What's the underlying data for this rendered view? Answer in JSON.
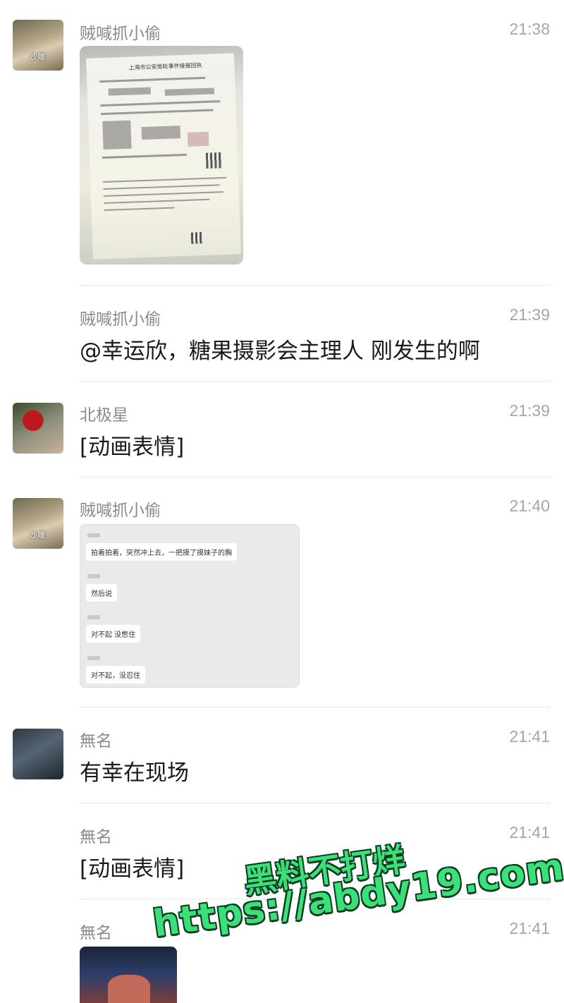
{
  "messages": [
    {
      "sender": "贼喊抓小偷",
      "time": "21:38",
      "type": "image",
      "image": "document-photo"
    },
    {
      "sender": "贼喊抓小偷",
      "time": "21:39",
      "type": "text",
      "text": "@幸运欣，糖果摄影会主理人 刚发生的啊"
    },
    {
      "sender": "北极星",
      "time": "21:39",
      "type": "text",
      "text": "[动画表情]"
    },
    {
      "sender": "贼喊抓小偷",
      "time": "21:40",
      "type": "image",
      "image": "chat-screenshot",
      "chat_lines": [
        "拍着拍着，突然冲上去，一把摸了摸妹子的胸",
        "然后说",
        "对不起 没憋住",
        "对不起，没忍住"
      ]
    },
    {
      "sender": "無名",
      "time": "21:41",
      "type": "text",
      "text": "有幸在现场"
    },
    {
      "sender": "無名",
      "time": "21:41",
      "type": "text",
      "text": "[动画表情]"
    },
    {
      "sender": "無名",
      "time": "21:41",
      "type": "image",
      "image": "cartoon-picture"
    }
  ],
  "avatars": {
    "squirrel_label": "沙雕"
  },
  "document": {
    "title": "上海市公安局轮事件接报回执"
  },
  "watermark": {
    "line1": "黑料不打烊",
    "line2": "https://abdy19.com"
  }
}
